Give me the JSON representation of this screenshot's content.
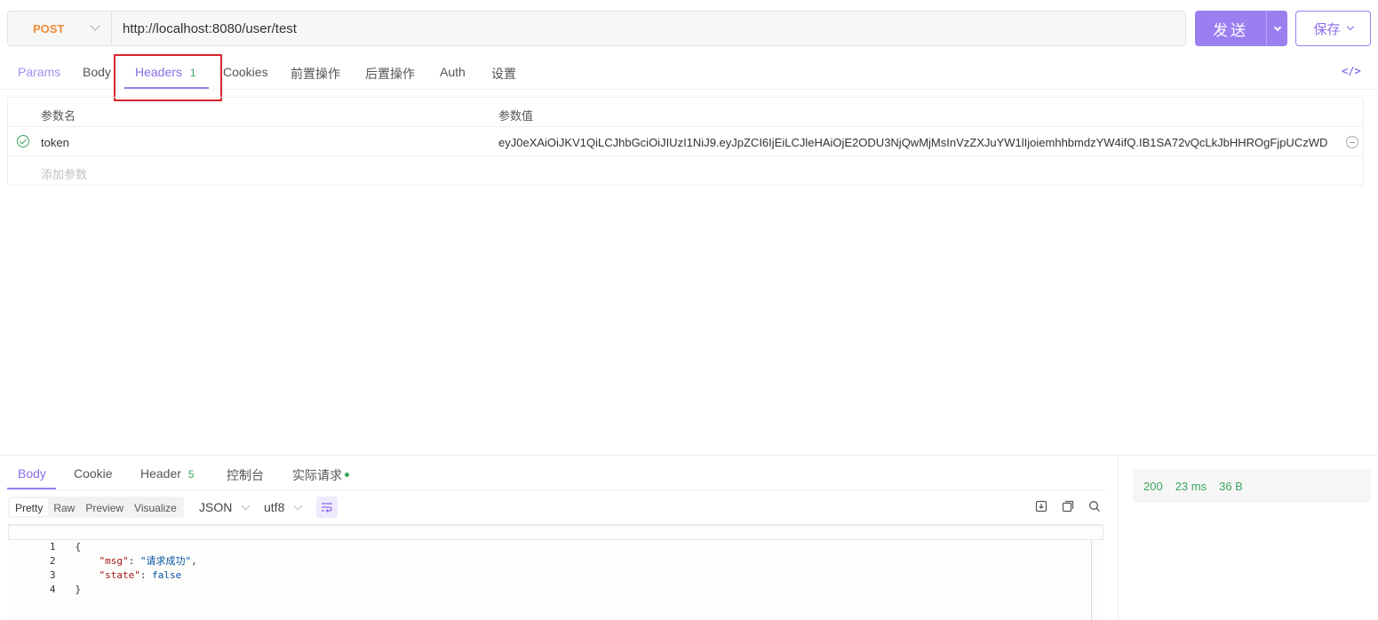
{
  "request": {
    "method": "POST",
    "url": "http://localhost:8080/user/test",
    "send_label": "发送",
    "save_label": "保存"
  },
  "request_tabs": {
    "params": "Params",
    "body": "Body",
    "headers": "Headers",
    "headers_count": "1",
    "cookies": "Cookies",
    "pre_script": "前置操作",
    "post_script": "后置操作",
    "auth": "Auth",
    "settings": "设置",
    "code_icon": "</>"
  },
  "headers_table": {
    "col_name": "参数名",
    "col_value": "参数值",
    "rows": [
      {
        "name": "token",
        "value": "eyJ0eXAiOiJKV1QiLCJhbGciOiJIUzI1NiJ9.eyJpZCI6IjEiLCJleHAiOjE2ODU3NjQwMjMsInVzZXJuYW1lIjoiemhhbmdzYW4ifQ.IB1SA72vQcLkJbHHROgFjpUCzWD"
      }
    ],
    "add_placeholder": "添加参数"
  },
  "response_tabs": {
    "body": "Body",
    "cookie": "Cookie",
    "header": "Header",
    "header_count": "5",
    "console": "控制台",
    "actual_request": "实际请求"
  },
  "response_toolbar": {
    "formats": [
      "Pretty",
      "Raw",
      "Preview",
      "Visualize"
    ],
    "active_format": "Pretty",
    "type": "JSON",
    "encoding": "utf8"
  },
  "response_body": {
    "lines": [
      {
        "n": "1",
        "text": "{"
      },
      {
        "n": "2",
        "key": "\"msg\"",
        "sep": ": ",
        "val": "\"请求成功\"",
        "tail": ","
      },
      {
        "n": "3",
        "key": "\"state\"",
        "sep": ": ",
        "val": "false",
        "tail": ""
      },
      {
        "n": "4",
        "text": "}"
      }
    ]
  },
  "response_status": {
    "code": "200",
    "time": "23 ms",
    "size": "36 B"
  }
}
